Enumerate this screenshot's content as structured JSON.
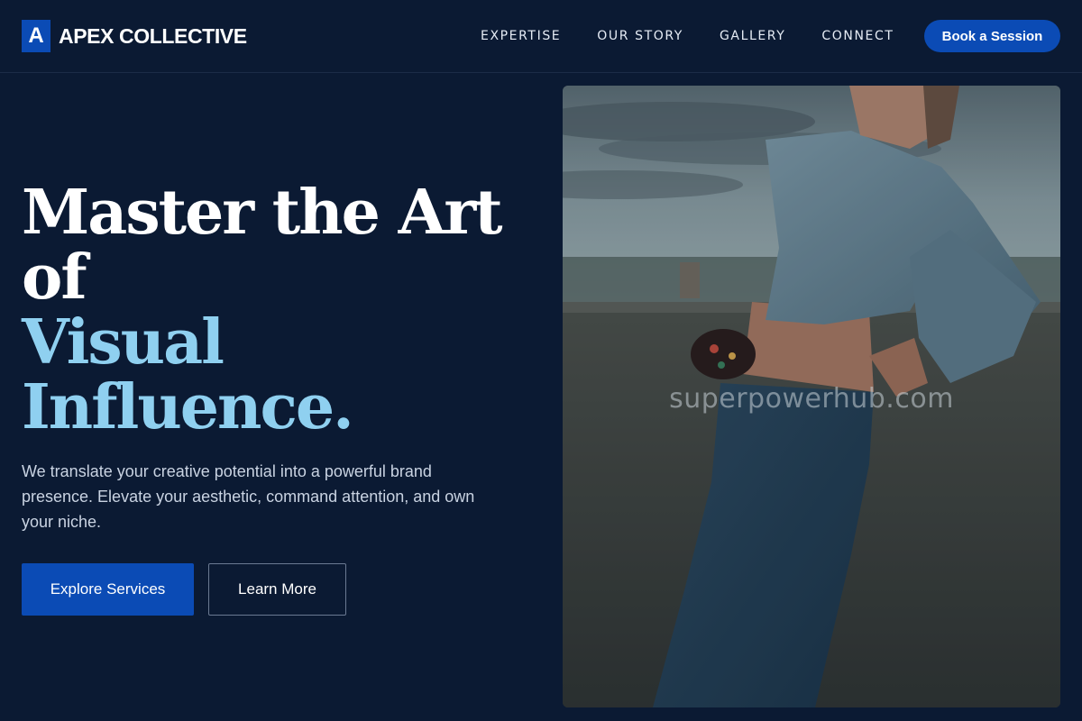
{
  "brand": {
    "mark": "A",
    "name": "APEX COLLECTIVE",
    "accent_color": "#0b4bb5"
  },
  "nav": {
    "items": [
      {
        "label": "EXPERTISE"
      },
      {
        "label": "OUR STORY"
      },
      {
        "label": "GALLERY"
      },
      {
        "label": "CONNECT"
      }
    ],
    "cta_label": "Book a Session"
  },
  "hero": {
    "headline_line1": "Master the Art",
    "headline_line2": "of",
    "headline_line3": "Visual",
    "headline_line4": "Influence.",
    "headline_accent_color": "#8fd0f0",
    "subtext": "We translate your creative potential into a powerful brand presence. Elevate your aesthetic, command attention, and own your niche.",
    "primary_button": "Explore Services",
    "secondary_button": "Learn More"
  },
  "image": {
    "watermark": "superpowerhub.com"
  },
  "colors": {
    "background": "#0b1a33",
    "button": "#0b4bb5"
  }
}
